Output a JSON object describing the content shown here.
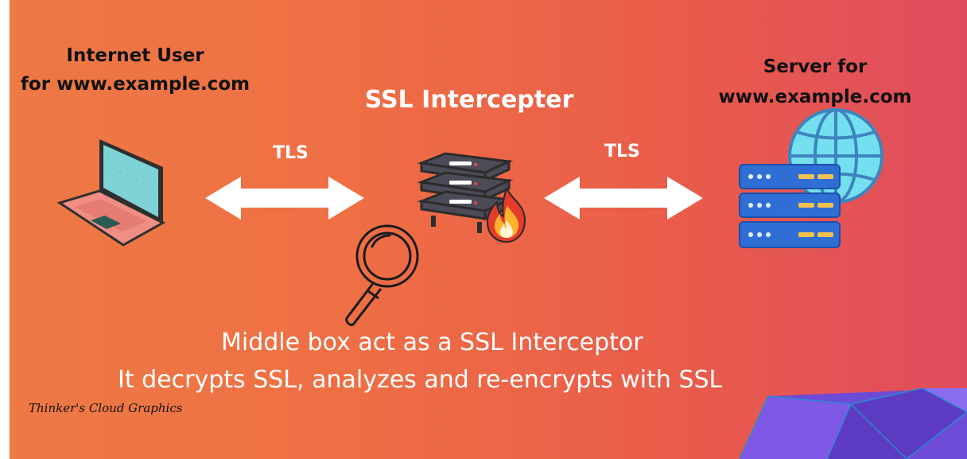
{
  "labels": {
    "user": "Internet User\nfor www.example.com",
    "middle": "SSL Intercepter",
    "server": "Server for\nwww.example.com",
    "tls_left": "TLS",
    "tls_right": "TLS"
  },
  "caption": {
    "line1": "Middle box act as a SSL Interceptor",
    "line2": "It  decrypts SSL, analyzes and re-encrypts  with  SSL"
  },
  "credit": "Thinker's Cloud Graphics",
  "icons": [
    "laptop-icon",
    "double-arrow-icon",
    "server-stack-icon",
    "fire-icon",
    "magnifier-icon",
    "globe-icon",
    "server-rack-icon"
  ]
}
